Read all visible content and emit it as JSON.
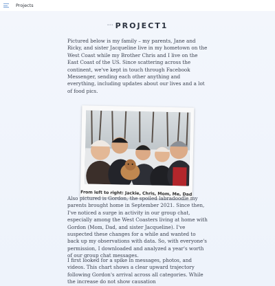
{
  "topbar": {
    "breadcrumb": "Projects",
    "menu_icon": "list-icon"
  },
  "page": {
    "title_icon": "ellipsis-icon",
    "title": "PROJECT1"
  },
  "paragraphs": [
    "Pictured below is my family – my parents, Jane and Ricky, and sister Jacqueline live in my hometown on the West Coast while my Brother Chris and I live on the East Coast of the US. Since scattering across the continent, we've kept in touch through Facebook Messenger, sending each other anything and everything, including updates about our lives and a lot of food pics.",
    "Also pictured is Gordon, the spoiled labradoodle my parents brought home in September 2021. Since then, I've noticed a surge in activity in our group chat, especially among the West Coasters living at home with Gordon (Mom, Dad, and sister Jacqueline). I've suspected these changes for a while and wanted to back up my observations with data. So, with everyone's permission, I downloaded and analyzed a year's worth of our group chat messages.",
    "I first looked for a spike in messages, photos, and videos. This chart shows a clear upward trajectory following Gordon's arrival across all categories. While the increase do not show causation"
  ],
  "photo": {
    "caption": "From left to right: Jackie, Chris, Mom, Me, Dad"
  },
  "colors": {
    "accent": "#7aa3d8",
    "background": "#eef3fb",
    "text": "#3c4250"
  }
}
